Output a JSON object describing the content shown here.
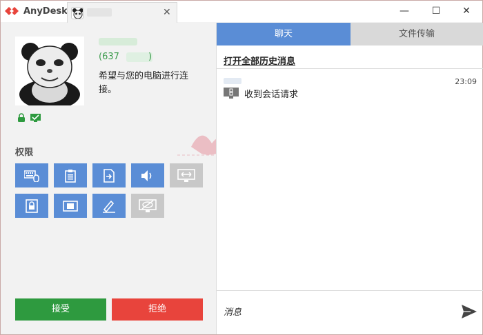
{
  "titlebar": {
    "app_name": "AnyDesk",
    "tab_close": "✕",
    "minimize": "—",
    "maximize": "☐",
    "close": "✕"
  },
  "session": {
    "user_id_prefix": "(637",
    "user_id_suffix": ")",
    "message": "希望与您的电脑进行连接。"
  },
  "permissions": {
    "title": "权限",
    "items": [
      {
        "name": "keyboard-mouse",
        "enabled": true
      },
      {
        "name": "clipboard",
        "enabled": true
      },
      {
        "name": "file-transfer",
        "enabled": true
      },
      {
        "name": "sound",
        "enabled": true
      },
      {
        "name": "screen-resize",
        "enabled": false
      },
      {
        "name": "lock",
        "enabled": true
      },
      {
        "name": "record",
        "enabled": true
      },
      {
        "name": "draw",
        "enabled": true
      },
      {
        "name": "privacy-mode",
        "enabled": false
      }
    ]
  },
  "actions": {
    "accept": "接受",
    "reject": "拒绝"
  },
  "chat": {
    "tab_chat": "聊天",
    "tab_files": "文件传输",
    "history_link": "打开全部历史消息",
    "time": "23:09",
    "message": "收到会话请求",
    "input_placeholder": "消息"
  },
  "colors": {
    "accent_blue": "#5a8dd6",
    "accept_green": "#2e9a3f",
    "reject_red": "#e8443c",
    "brand_red": "#e8443c"
  }
}
